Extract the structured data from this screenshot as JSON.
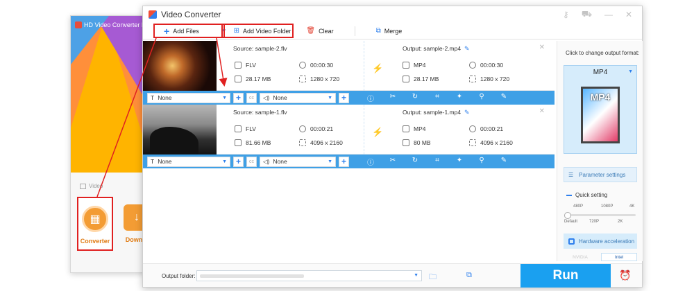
{
  "launcher": {
    "title": "HD Video Converter F",
    "section_label": "Video",
    "tiles": [
      {
        "label": "Converter",
        "icon": "film-icon"
      },
      {
        "label": "Downlo",
        "icon": "download-icon"
      }
    ]
  },
  "window": {
    "title": "Video Converter"
  },
  "toolbar": {
    "add_files": "Add Files",
    "add_video_folder": "Add Video Folder",
    "clear": "Clear",
    "merge": "Merge"
  },
  "files": [
    {
      "source": "Source: sample-2.flv",
      "output": "Output: sample-2.mp4",
      "src_format": "FLV",
      "src_duration": "00:00:30",
      "src_size": "28.17 MB",
      "src_resolution": "1280 x 720",
      "out_format": "MP4",
      "out_duration": "00:00:30",
      "out_size": "28.17 MB",
      "out_resolution": "1280 x 720",
      "subtitle": "None",
      "audio": "None"
    },
    {
      "source": "Source: sample-1.flv",
      "output": "Output: sample-1.mp4",
      "src_format": "FLV",
      "src_duration": "00:00:21",
      "src_size": "81.66 MB",
      "src_resolution": "4096 x 2160",
      "out_format": "MP4",
      "out_duration": "00:00:21",
      "out_size": "80 MB",
      "out_resolution": "4096 x 2160",
      "subtitle": "None",
      "audio": "None"
    }
  ],
  "right_panel": {
    "label": "Click to change output format:",
    "format": "MP4",
    "format_icon_text": "MP4",
    "parameter_settings": "Parameter settings",
    "quick_setting": "Quick setting",
    "quality_top": [
      "480P",
      "1080P",
      "4K"
    ],
    "quality_bottom": [
      "Default",
      "720P",
      "2K"
    ],
    "quality_level": 0,
    "hardware_acceleration": "Hardware acceleration",
    "gpu_nvidia": "NVIDIA",
    "gpu_intel": "Intel"
  },
  "bottom": {
    "output_folder_label": "Output folder:",
    "run": "Run"
  },
  "colors": {
    "accent": "#1aa0f0",
    "highlight": "#e02020",
    "toolbar_bar": "#3fa0e6"
  }
}
